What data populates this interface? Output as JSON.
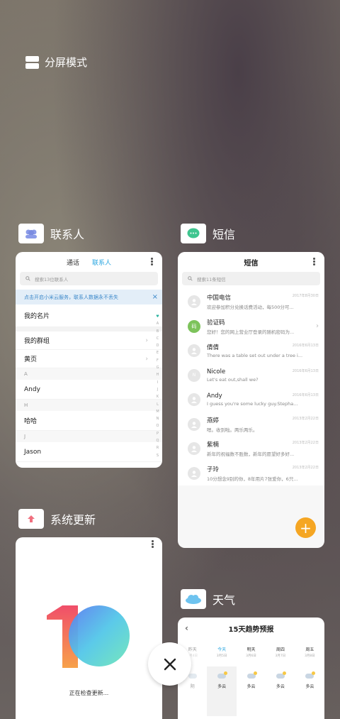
{
  "split_screen": {
    "label": "分屏模式"
  },
  "close": {
    "label": "×"
  },
  "contacts": {
    "title": "联系人",
    "tabs": [
      "通话",
      "联系人"
    ],
    "search_placeholder": "搜索13位联系人",
    "banner": "点击开启小米云服务，联系人数据永不丢失",
    "banner_close": "×",
    "rows": [
      "我的名片",
      "我的群组",
      "黄页"
    ],
    "groups": [
      {
        "letter": "A",
        "name": "Andy"
      },
      {
        "letter": "H",
        "name": "哈哈"
      },
      {
        "letter": "J",
        "name": "Jason"
      }
    ],
    "alphabet": [
      "A",
      "B",
      "C",
      "D",
      "E",
      "F",
      "G",
      "H",
      "I",
      "J",
      "K",
      "L",
      "M",
      "N",
      "O",
      "P",
      "Q",
      "R",
      "S"
    ]
  },
  "sms": {
    "title": "短信",
    "header": "短信",
    "search_placeholder": "搜索11条短信",
    "messages": [
      {
        "name": "中国电信",
        "date": "2017年8月30日",
        "preview": "欢迎参加积分兑换话费活动，每500分可..."
      },
      {
        "name": "验证码",
        "date": "",
        "preview": "您好！您的网上营业厅登录的随机密码为...",
        "avatar": "码"
      },
      {
        "name": "倩倩",
        "date": "2016年6月13日",
        "preview": "There was a table set out under a tree i..."
      },
      {
        "name": "Nicole",
        "date": "2016年6月13日",
        "preview": "Let's eat out,shall we?",
        "avatar": "N"
      },
      {
        "name": "Andy",
        "date": "2016年6月13日",
        "preview": "I guess you're some lucky guy.Stepha..."
      },
      {
        "name": "燕婷",
        "date": "2013年2月22日",
        "preview": "嗯。收到啦。两乐两乐。"
      },
      {
        "name": "紫楠",
        "date": "2013年2月22日",
        "preview": "新年的祝福数不胜数，新年的愿望好多好..."
      },
      {
        "name": "子玲",
        "date": "2013年2月22日",
        "preview": "10分想念9别的你，8年用片7张爱你，6只..."
      }
    ],
    "fab": "+"
  },
  "update": {
    "title": "系统更新",
    "status": "正在检查更新..."
  },
  "weather": {
    "title": "天气",
    "header": "15天趋势预报",
    "days": [
      {
        "name": "昨天",
        "date": "3月4日"
      },
      {
        "name": "今天",
        "date": "3月5日"
      },
      {
        "name": "明天",
        "date": "3月6日"
      },
      {
        "name": "周四",
        "date": "3月7日"
      },
      {
        "name": "周五",
        "date": "3月8日"
      }
    ],
    "conditions": [
      "阴",
      "多云",
      "多云",
      "多云",
      "多云"
    ]
  }
}
